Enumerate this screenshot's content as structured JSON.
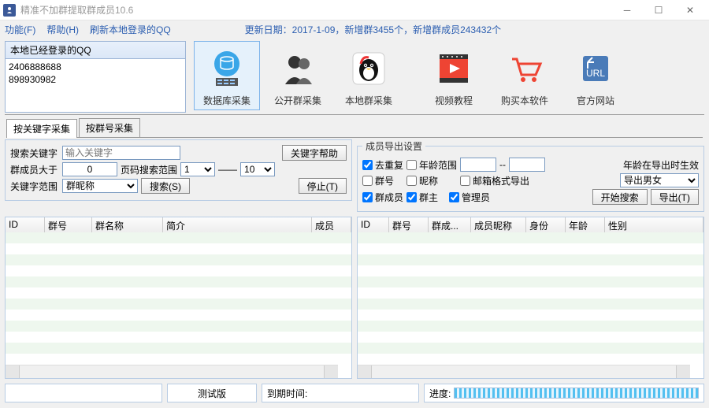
{
  "window": {
    "title": "精准不加群提取群成员10.6"
  },
  "menu": {
    "func": "功能(F)",
    "help": "帮助(H)",
    "refresh": "刷新本地登录的QQ",
    "update": "更新日期：2017-1-09，新增群3455个，新增群成员243432个"
  },
  "qq": {
    "header": "本地已经登录的QQ",
    "items": [
      "2406888688",
      "898930982"
    ]
  },
  "toolbar": {
    "db": "数据库采集",
    "public": "公开群采集",
    "local": "本地群采集",
    "video": "视频教程",
    "buy": "购买本软件",
    "site": "官方网站"
  },
  "tabs": {
    "t1": "按关键字采集",
    "t2": "按群号采集"
  },
  "left": {
    "row1": {
      "label": "搜索关键字",
      "placeholder": "输入关键字",
      "help": "关键字帮助"
    },
    "row2": {
      "label": "群成员大于",
      "value": "0",
      "pages": "页码搜索范围",
      "p1": "1",
      "p2": "10"
    },
    "row3": {
      "label": "关键字范围",
      "scope": "群昵称",
      "search": "搜索(S)",
      "stop": "停止(T)"
    }
  },
  "right": {
    "legend": "成员导出设置",
    "dedup": "去重复",
    "age": "年龄范围",
    "ageRule": "年龄在导出时生效",
    "dash": "--",
    "groupno": "群号",
    "nick": "昵称",
    "mail": "邮箱格式导出",
    "gender": "导出男女",
    "member": "群成员",
    "owner": "群主",
    "admin": "管理员",
    "startSearch": "开始搜索",
    "export": "导出(T)"
  },
  "leftCols": {
    "c1": "ID",
    "c2": "群号",
    "c3": "群名称",
    "c4": "简介",
    "c5": "成员"
  },
  "rightCols": {
    "c1": "ID",
    "c2": "群号",
    "c3": "群成...",
    "c4": "成员昵称",
    "c5": "身份",
    "c6": "年龄",
    "c7": "性别"
  },
  "footer": {
    "trial": "测试版",
    "expire": "到期时间:",
    "progress": "进度:"
  }
}
